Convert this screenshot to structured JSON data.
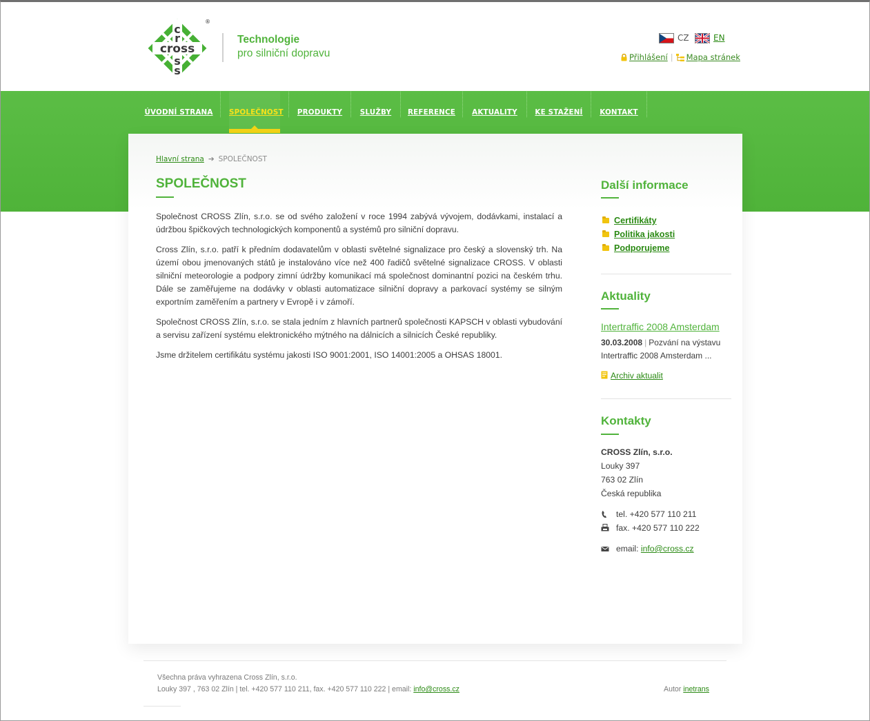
{
  "header": {
    "logo_text": "cross",
    "logo_registered": "®",
    "tagline_line1": "Technologie",
    "tagline_line2": "pro silniční dopravu",
    "languages": [
      {
        "code": "CZ",
        "active": true
      },
      {
        "code": "EN",
        "active": false
      }
    ],
    "login_label": "Přihlášení",
    "separator": "|",
    "sitemap_label": "Mapa stránek"
  },
  "nav": {
    "items": [
      {
        "label": "ÚVODNÍ STRANA"
      },
      {
        "label": "SPOLEČNOST"
      },
      {
        "label": "PRODUKTY"
      },
      {
        "label": "SLUŽBY"
      },
      {
        "label": "REFERENCE"
      },
      {
        "label": "AKTUALITY"
      },
      {
        "label": "KE STAŽENÍ"
      },
      {
        "label": "KONTAKT"
      }
    ],
    "active_label": "SPOLEČNOST"
  },
  "breadcrumb": {
    "home": "Hlavní strana",
    "arrow": "➔",
    "current": "SPOLEČNOST"
  },
  "main": {
    "title": "SPOLEČNOST",
    "paragraphs": [
      "Společnost CROSS Zlín, s.r.o. se od svého založení v roce 1994 zabývá vývojem, dodávkami, instalací a údržbou špičkových technologických komponentů a systémů pro silniční dopravu.",
      "Cross Zlín, s.r.o. patří k předním dodavatelům v oblasti světelné signalizace pro český a slovenský trh. Na území obou jmenovaných států je instalováno více než 400 řadičů světelné signalizace CROSS. V oblasti silniční meteorologie a podpory zimní údržby komunikací má společnost dominantní pozici na českém trhu. Dále se zaměřujeme na dodávky v oblasti automatizace silniční dopravy a parkovací systémy se silným exportním zaměřením a partnery v Evropě i v zámoří.",
      "Společnost CROSS Zlín, s.r.o. se stala jedním z hlavních partnerů společnosti KAPSCH v oblasti vybudování a servisu zařízení systému elektronického mýtného na dálnicích a silnicích České republiky.",
      "Jsme držitelem certifikátu systému jakosti ISO 9001:2001, ISO 14001:2005 a OHSAS 18001."
    ]
  },
  "sidebar": {
    "info_title": "Další informace",
    "info_links": [
      "Certifikáty",
      "Politika jakosti",
      "Podporujeme"
    ],
    "news_title": "Aktuality",
    "news_item_title": "Intertraffic 2008 Amsterdam",
    "news_item_date": "30.03.2008",
    "news_item_sep": "|",
    "news_item_text": "Pozvání na výstavu Intertraffic 2008 Amsterdam ...",
    "archive_label": "Archiv aktualit",
    "contact_title": "Kontakty",
    "company": "CROSS Zlín, s.r.o.",
    "street": "Louky 397",
    "city": "763 02 Zlín",
    "country": "Česká republika",
    "phone": "tel. +420 577 110 211",
    "fax": "fax. +420 577 110 222",
    "email_label": "email:",
    "email": "info@cross.cz"
  },
  "footer": {
    "copyright": "Všechna práva vyhrazena Cross Zlín, s.r.o.",
    "address_line": "Louky 397 , 763 02 Zlín | tel. +420 577 110 211, fax. +420 577 110 222 | email:",
    "email": "info@cross.cz",
    "author_label": "Autor",
    "author_link": "inetrans"
  },
  "colors": {
    "brand_green": "#50b33b",
    "active_yellow": "#f4d416",
    "link_green": "#2b8a14"
  }
}
